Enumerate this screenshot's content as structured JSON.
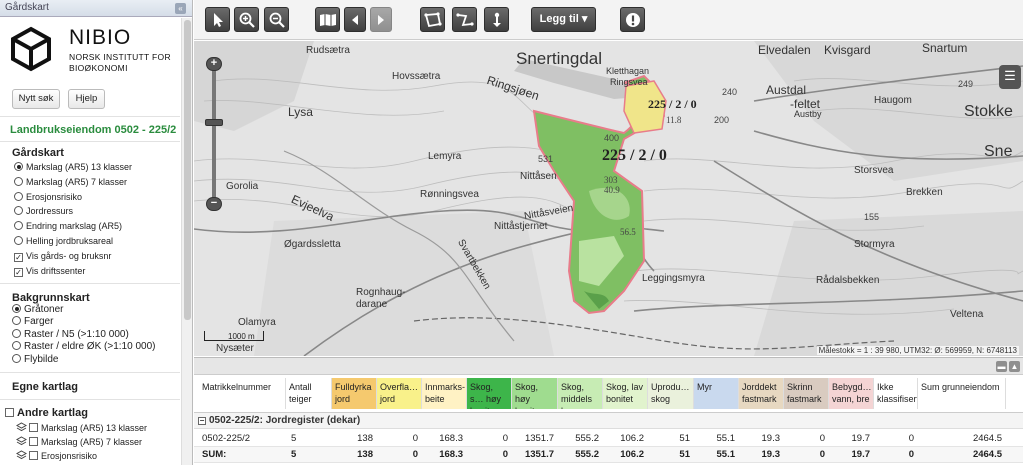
{
  "left_panel": {
    "header": "Gårdskart",
    "collapse_icon": "«",
    "logo_name": "NIBIO",
    "logo_sub1": "NORSK INSTITUTT FOR",
    "logo_sub2": "BIOØKONOMI",
    "new_search": "Nytt søk",
    "help": "Hjelp",
    "property_title": "Landbrukseiendom 0502 - 225/2",
    "gardskart_title": "Gårdskart",
    "gardskart_options": [
      {
        "label": "Markslag (AR5) 13 klasser",
        "type": "radio",
        "checked": true
      },
      {
        "label": "Markslag (AR5) 7 klasser",
        "type": "radio",
        "checked": false
      },
      {
        "label": "Erosjonsrisiko",
        "type": "radio",
        "checked": false
      },
      {
        "label": "Jordressurs",
        "type": "radio",
        "checked": false
      },
      {
        "label": "Endring markslag (AR5)",
        "type": "radio",
        "checked": false
      },
      {
        "label": "Helling jordbruksareal",
        "type": "radio",
        "checked": false
      },
      {
        "label": "Vis gårds- og bruksnr",
        "type": "checkbox",
        "checked": true
      },
      {
        "label": "Vis driftssenter",
        "type": "checkbox",
        "checked": true
      }
    ],
    "bakgrunn_title": "Bakgrunnskart",
    "bakgrunn_options": [
      {
        "label": "Gråtoner",
        "checked": true
      },
      {
        "label": "Farger",
        "checked": false
      },
      {
        "label": "Raster / N5 (>1:10 000)",
        "checked": false
      },
      {
        "label": "Raster / eldre ØK (>1:10 000)",
        "checked": false
      },
      {
        "label": "Flybilde",
        "checked": false
      }
    ],
    "egne_title": "Egne kartlag",
    "andre_title": "Andre kartlag",
    "andre_layers": [
      "Markslag (AR5) 13 klasser",
      "Markslag (AR5) 7 klasser",
      "Erosjonsrisiko"
    ]
  },
  "toolbar": {
    "legg_til": "Legg til ▾",
    "tools": [
      "select-arrow-icon",
      "zoom-in-icon",
      "zoom-out-icon",
      "map-book-icon",
      "back-icon",
      "forward-icon",
      "measure-area-icon",
      "measure-line-icon",
      "pin-icon",
      "info-icon"
    ]
  },
  "map": {
    "labels": {
      "rudsaetra": "Rudsætra",
      "hovssaetra": "Hovssætra",
      "snertingdal": "Snertingdal",
      "klettangen": "Kletthagan",
      "ringsvea": "Ringsvea",
      "elvedalen": "Elvedalen",
      "kvisgard": "Kvisgard",
      "snartum": "Snartum",
      "austdal": "Austdal",
      "feltet": "-feltet",
      "austby": "Austby",
      "haugom": "Haugom",
      "stokke": "Stokke",
      "sne": "Sne",
      "lysa": "Lysa",
      "ringsjoen": "Ringsjøen",
      "lemyra": "Lemyra",
      "nittasen": "Nittåsen",
      "gorolia": "Gorolia",
      "ronningsvea": "Rønningsvea",
      "evjeelva": "Evjeelva",
      "nittasveien": "Nittåsveien",
      "nittasjernet": "Nittåstjernet",
      "ogardssletta": "Øgardssletta",
      "svartbekken": "Svartbekken",
      "storsvea": "Storsvea",
      "brekken": "Brekken",
      "stormyra": "Stormyra",
      "radalsbekken": "Rådalsbekken",
      "leggingsmyra": "Leggingsmyra",
      "rognhaug": "Rognhaug-",
      "darane": "darane",
      "olamyra": "Olamyra",
      "nysaeter": "Nysæter",
      "veltena": "Veltena",
      "property_label": "225 / 2 / 0",
      "property_label2": "225 / 2 / 0",
      "e531": "531",
      "e155": "155",
      "e249": "249",
      "e240": "240",
      "e200": "200",
      "e400": "400",
      "e303": "303",
      "e40": "40.9",
      "e56": "56.5",
      "e11": "11.8"
    },
    "scale_text": "1000 m",
    "footer": "Målestokk = 1 : 39 980, UTM32: Ø: 569959, N: 6748113"
  },
  "table": {
    "headers": [
      "Matrikkelnummer",
      "Antall teiger",
      "Fulldyrka jord",
      "Overfla… jord",
      "Innmarks-beite",
      "Skog, s… høy bonite",
      "Skog, høy bonite",
      "Skog, middels bo",
      "Skog, lav bonitet",
      "Uprodu… skog",
      "Myr",
      "Jorddekt fastmark",
      "Skrinn fastmark",
      "Bebygd… vann, bre",
      "Ikke klassifisert",
      "Sum grunneiendom"
    ],
    "header_colors": [
      "#ffffff",
      "#ffffff",
      "#f5c96e",
      "#f9f18a",
      "#fff2c4",
      "#3db54a",
      "#9fdc8f",
      "#c7ecb4",
      "#e1f3cd",
      "#eaf1dc",
      "#c9d9ee",
      "#e7d8c1",
      "#d9cbc0",
      "#f4d4d4",
      "#ffffff",
      "#ffffff"
    ],
    "group_label": "0502-225/2: Jordregister (dekar)",
    "rows": [
      {
        "cells": [
          "0502-225/2",
          "5",
          "138",
          "0",
          "168.3",
          "0",
          "1351.7",
          "555.2",
          "106.2",
          "51",
          "55.1",
          "19.3",
          "0",
          "19.7",
          "0",
          "2464.5"
        ]
      },
      {
        "cells": [
          "SUM:",
          "5",
          "138",
          "0",
          "168.3",
          "0",
          "1351.7",
          "555.2",
          "106.2",
          "51",
          "55.1",
          "19.3",
          "0",
          "19.7",
          "0",
          "2464.5"
        ]
      }
    ]
  }
}
